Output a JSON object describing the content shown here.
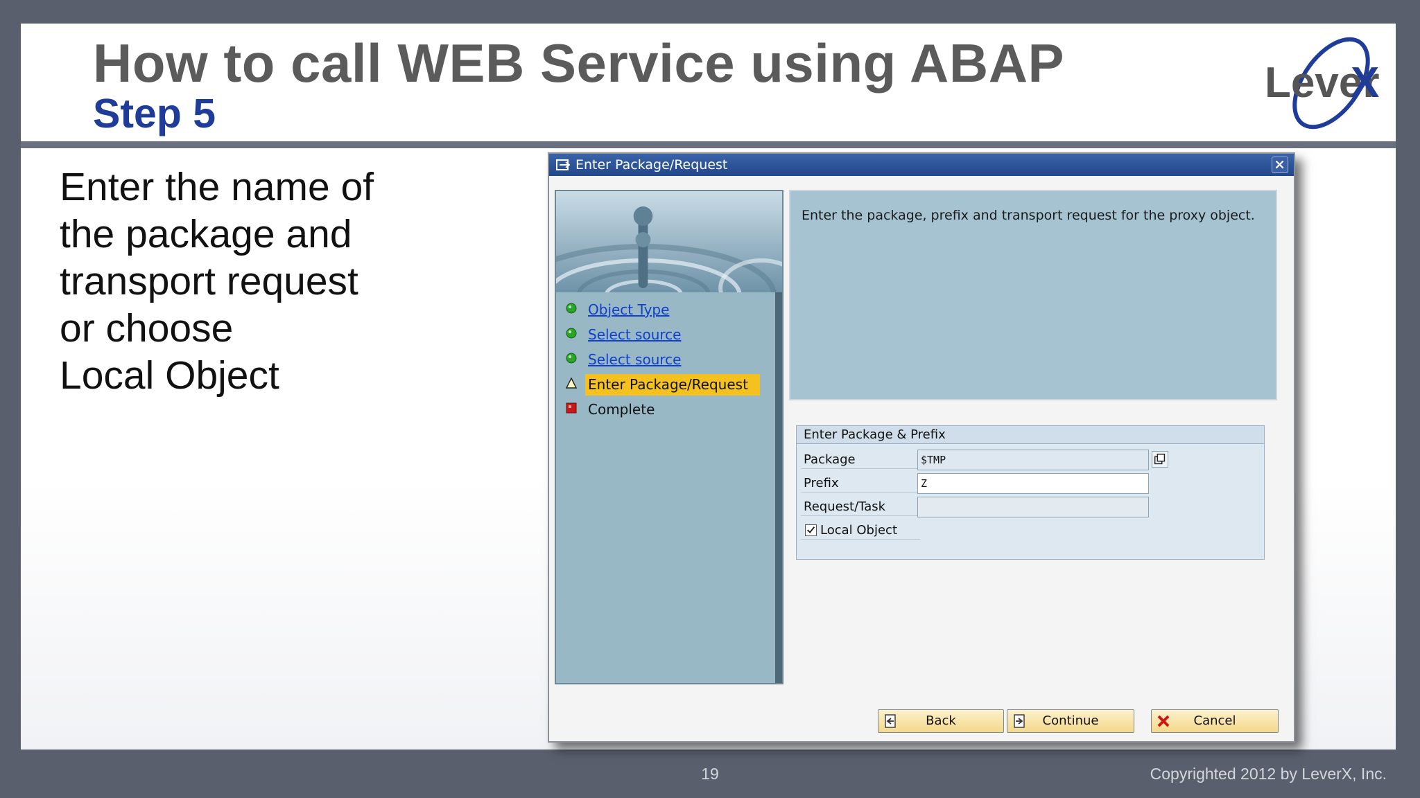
{
  "slide": {
    "title": "How to call WEB Service using ABAP",
    "subtitle": "Step 5",
    "logo_text": "LeverX",
    "body_lines": [
      "Enter the name of",
      "the package and",
      "transport request",
      "or choose",
      "Local Object"
    ],
    "page_number": "19",
    "copyright": "Copyrighted 2012 by LeverX, Inc."
  },
  "dialog": {
    "title": "Enter Package/Request",
    "info_text": "Enter the package, prefix and transport request for the proxy object.",
    "nav_items": [
      {
        "label": "Object Type",
        "status": "done",
        "icon": "green-circle-icon"
      },
      {
        "label": "Select source",
        "status": "done",
        "icon": "green-circle-icon"
      },
      {
        "label": "Select source",
        "status": "done",
        "icon": "green-circle-icon"
      },
      {
        "label": "Enter Package/Request",
        "status": "current",
        "icon": "warning-triangle-icon"
      },
      {
        "label": "Complete",
        "status": "pending",
        "icon": "red-square-icon"
      }
    ],
    "group_title": "Enter Package & Prefix",
    "fields": {
      "package_label": "Package",
      "package_value": "$TMP",
      "prefix_label": "Prefix",
      "prefix_value": "Z",
      "request_label": "Request/Task",
      "request_value": "",
      "local_object_label": "Local Object",
      "local_object_checked": true
    },
    "buttons": {
      "back": "Back",
      "continue": "Continue",
      "cancel": "Cancel"
    }
  },
  "colors": {
    "title_gray": "#5b5b5b",
    "subtitle_blue": "#1f3c99",
    "active_step_yellow": "#f5c11e",
    "sap_titlebar_blue": "#22468a"
  }
}
